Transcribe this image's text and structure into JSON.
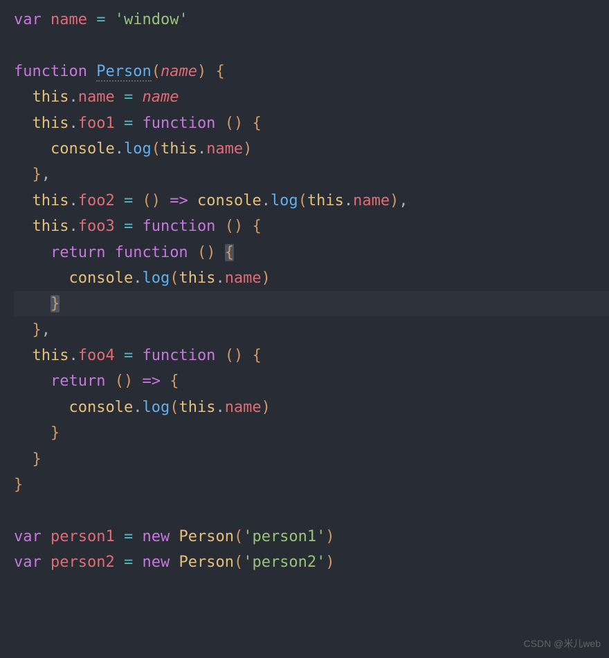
{
  "code": {
    "tokens": {
      "var": "var",
      "name": "name",
      "window_str": "'window'",
      "function": "function",
      "Person": "Person",
      "param_name": "name",
      "this": "this",
      "foo1": "foo1",
      "foo2": "foo2",
      "foo3": "foo3",
      "foo4": "foo4",
      "console": "console",
      "log": "log",
      "return": "return",
      "new": "new",
      "person1": "person1",
      "person2": "person2",
      "person1_str": "'person1'",
      "person2_str": "'person2'",
      "eq": "=",
      "arrow": "=>",
      "lparen": "(",
      "rparen": ")",
      "lbrace": "{",
      "rbrace": "}",
      "comma": ",",
      "dot": "."
    }
  },
  "watermark": "CSDN @米儿web"
}
